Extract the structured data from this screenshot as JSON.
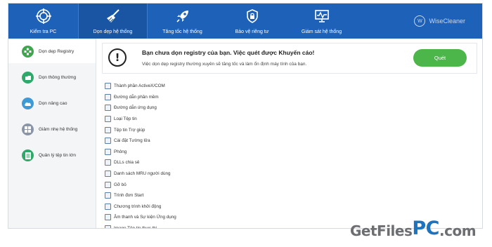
{
  "nav": {
    "items": [
      {
        "label": "Kiểm tra PC",
        "icon": "target-icon"
      },
      {
        "label": "Dọn dẹp hệ thống",
        "icon": "broom-icon"
      },
      {
        "label": "Tăng tốc hệ thống",
        "icon": "rocket-icon"
      },
      {
        "label": "Bảo vệ riêng tư",
        "icon": "shield-lock-icon"
      },
      {
        "label": "Giám sát hệ thống",
        "icon": "monitor-icon"
      }
    ],
    "active_index": 1,
    "brand": "WiseCleaner",
    "brand_logo": "W"
  },
  "sidebar": {
    "items": [
      {
        "label": "Dọn dẹp Registry",
        "icon": "registry-icon",
        "color": "#3ea64e"
      },
      {
        "label": "Dọn thông thường",
        "icon": "folder-clean-icon",
        "color": "#2fa96a"
      },
      {
        "label": "Dọn nâng cao",
        "icon": "cloud-icon",
        "color": "#3d9ad6"
      },
      {
        "label": "Giảm nhẹ hệ thống",
        "icon": "windows-icon",
        "color": "#8a96a8"
      },
      {
        "label": "Quản lý tệp tin lớn",
        "icon": "file-icon",
        "color": "#2fa96a"
      }
    ],
    "active_index": 0
  },
  "banner": {
    "alert_symbol": "!",
    "title": "Bạn chưa dọn registry của bạn. Việc quét được Khuyến cáo!",
    "subtitle": "Việc dọn dẹp registry thường xuyên sẽ tăng tốc và làm ổn định máy tính của bạn.",
    "scan_label": "Quét"
  },
  "registry_items": [
    "Thành phần ActiveX/COM",
    "Đường dẫn phần mềm",
    "Đường dẫn ứng dụng",
    "Loại Tệp tin",
    "Tệp tin Trợ giúp",
    "Cài đặt Tường lửa",
    "Phông",
    "DLLs chia sẻ",
    "Danh sách MRU người dùng",
    "Gỡ bỏ",
    "Trình đơn Start",
    "Chương trình khởi động",
    "Âm thanh và Sự kiện Ứng dụng",
    "Image Tệp tin thực thi"
  ],
  "watermark": {
    "part1": "GetFiles",
    "part2": "PC",
    "part3": ".com"
  },
  "colors": {
    "topbar": "#1e61b8",
    "scan_button": "#4cb64a",
    "sidebar_bg": "#f3f5f7"
  }
}
